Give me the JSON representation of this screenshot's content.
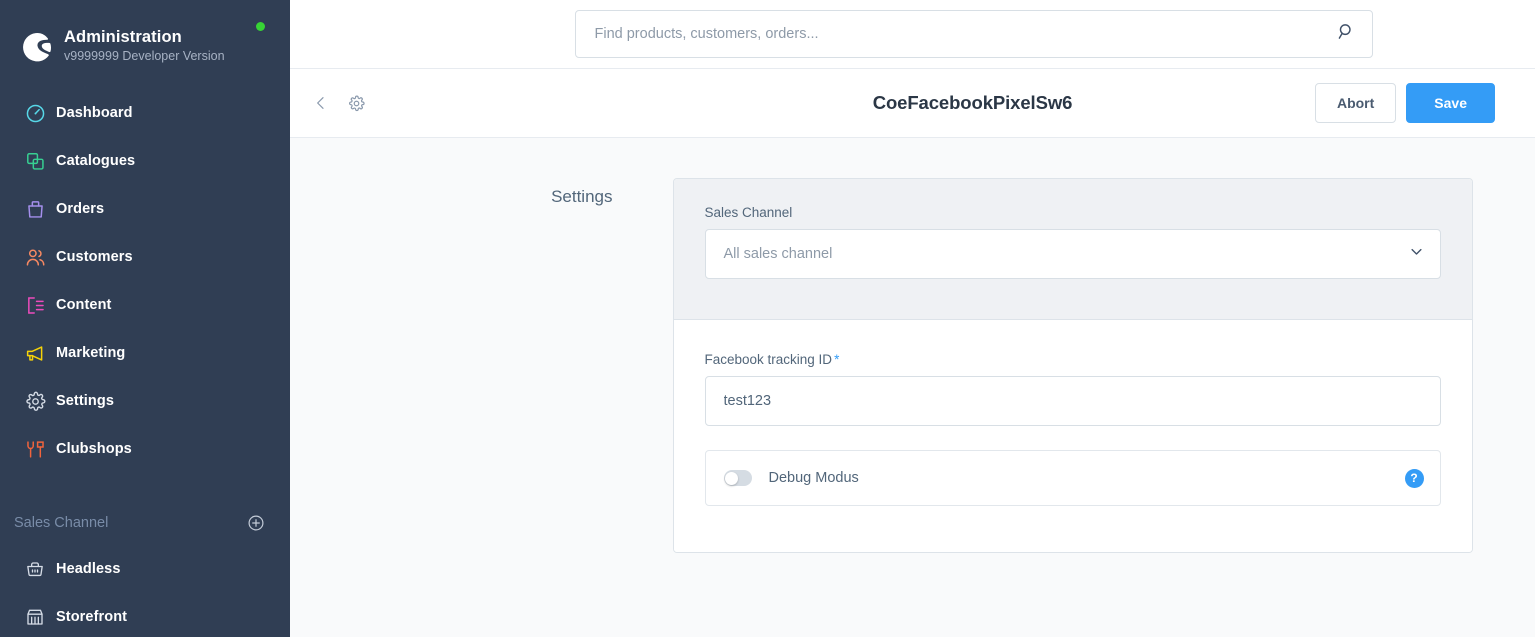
{
  "sidebar": {
    "logo_icon": "shopware-logo-icon",
    "title": "Administration",
    "version": "v9999999 Developer Version",
    "status_dot": "online-status-dot",
    "status_color": "#37d435",
    "items": [
      {
        "label": "Dashboard",
        "icon": "dashboard-icon",
        "color": "#57d8e8"
      },
      {
        "label": "Catalogues",
        "icon": "catalogues-icon",
        "color": "#37d092"
      },
      {
        "label": "Orders",
        "icon": "orders-icon",
        "color": "#a48fec"
      },
      {
        "label": "Customers",
        "icon": "customers-icon",
        "color": "#f88962"
      },
      {
        "label": "Content",
        "icon": "content-icon",
        "color": "#ed4bbd"
      },
      {
        "label": "Marketing",
        "icon": "marketing-icon",
        "color": "#f5d208"
      },
      {
        "label": "Settings",
        "icon": "gear-icon",
        "color": "#d5dce6"
      },
      {
        "label": "Clubshops",
        "icon": "clubshops-icon",
        "color": "#f2643c"
      }
    ],
    "section": {
      "label": "Sales Channel",
      "add_icon": "plus-circle-icon",
      "items": [
        {
          "label": "Headless",
          "icon": "basket-icon",
          "color": "#d5dce6"
        },
        {
          "label": "Storefront",
          "icon": "storefront-icon",
          "color": "#d5dce6"
        }
      ]
    }
  },
  "topbar": {
    "search_placeholder": "Find products, customers, orders...",
    "search_value": "",
    "search_icon": "search-icon"
  },
  "page_header": {
    "back_icon": "chevron-left-icon",
    "settings_icon": "gear-icon",
    "title": "CoeFacebookPixelSw6",
    "abort_label": "Abort",
    "save_label": "Save",
    "save_color": "#349cf6"
  },
  "settings": {
    "section_title": "Settings",
    "sales_channel": {
      "label": "Sales Channel",
      "value": "All sales channel",
      "chevron_icon": "chevron-down-icon"
    },
    "tracking_id": {
      "label": "Facebook tracking ID",
      "required_mark": "*",
      "value": "test123"
    },
    "debug": {
      "label": "Debug Modus",
      "enabled": false,
      "help_icon": "help-circle-icon",
      "help_label": "?"
    }
  }
}
